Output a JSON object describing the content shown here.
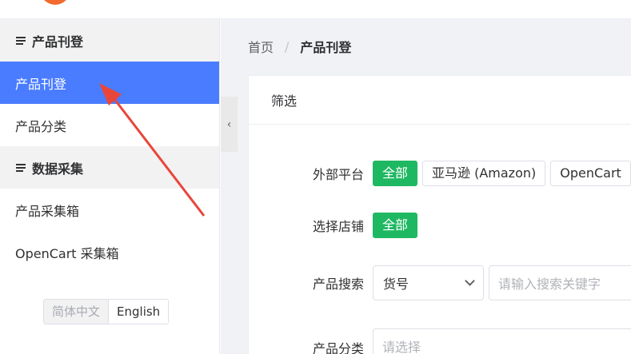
{
  "sidebar": {
    "groups": [
      {
        "title": "产品刊登",
        "items": [
          "产品刊登",
          "产品分类"
        ]
      },
      {
        "title": "数据采集",
        "items": [
          "产品采集箱",
          "OpenCart 采集箱"
        ]
      }
    ],
    "active_item": "产品刊登",
    "language": {
      "options": [
        "简体中文",
        "English"
      ],
      "selected": "English"
    }
  },
  "breadcrumb": {
    "home": "首页",
    "separator": "/",
    "current": "产品刊登"
  },
  "filter": {
    "title": "筛选",
    "platform": {
      "label": "外部平台",
      "options": [
        "全部",
        "亚马逊 (Amazon)",
        "OpenCart"
      ],
      "selected": "全部"
    },
    "store": {
      "label": "选择店铺",
      "options": [
        "全部"
      ],
      "selected": "全部"
    },
    "search": {
      "label": "产品搜索",
      "field_value": "货号",
      "placeholder": "请输入搜索关键字"
    },
    "category": {
      "label": "产品分类",
      "placeholder": "请选择"
    }
  },
  "colors": {
    "accent": "#4a7cff",
    "selected_tag": "#1fb862",
    "annotation_arrow": "#e8463a"
  }
}
